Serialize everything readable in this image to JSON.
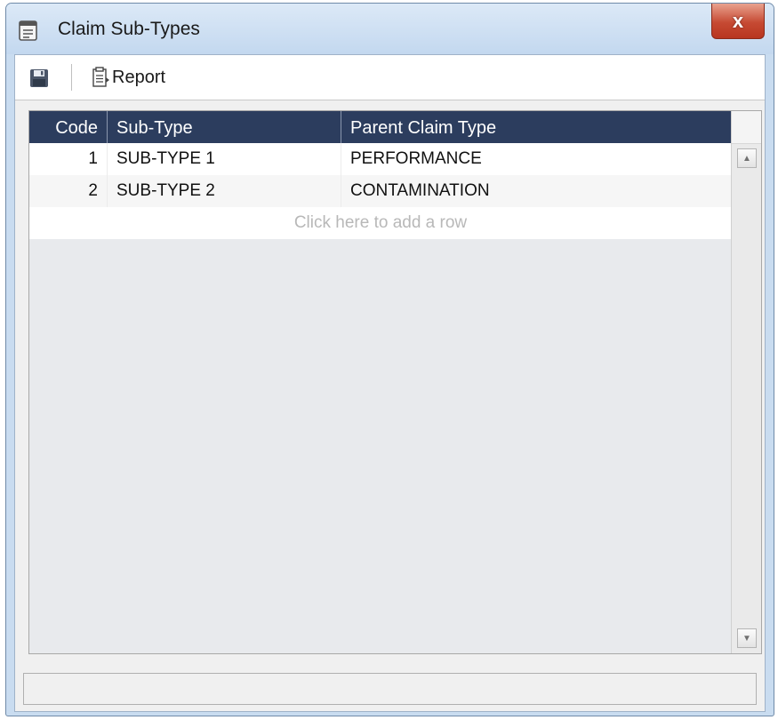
{
  "window": {
    "title": "Claim Sub-Types",
    "close_label": "x"
  },
  "toolbar": {
    "report_label": "Report"
  },
  "grid": {
    "columns": [
      "Code",
      "Sub-Type",
      "Parent Claim Type"
    ],
    "rows": [
      {
        "code": "1",
        "sub_type": "SUB-TYPE 1",
        "parent": "PERFORMANCE"
      },
      {
        "code": "2",
        "sub_type": "SUB-TYPE 2",
        "parent": "CONTAMINATION"
      }
    ],
    "add_row_text": "Click here to add a row"
  },
  "colors": {
    "header_bg": "#2c3d5e",
    "titlebar": "#c9dcf0",
    "close_button": "#c64a33"
  }
}
